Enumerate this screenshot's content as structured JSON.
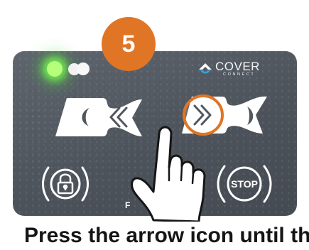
{
  "step": {
    "number": "5"
  },
  "brand": {
    "name": "COVER",
    "subname": "CONNECT"
  },
  "controls": {
    "reverse_icon": "double-chevron-left-icon",
    "forward_icon": "double-chevron-right-icon",
    "lock_icon": "padlock-icon",
    "stop_label": "STOP"
  },
  "panel": {
    "partial_text": "F"
  },
  "caption": {
    "text": "Press the arrow icon until the"
  },
  "colors": {
    "accent": "#e07525",
    "panel": "#50565e",
    "led": "#8cff5a",
    "icon": "#ffffff",
    "text": "#151515"
  }
}
